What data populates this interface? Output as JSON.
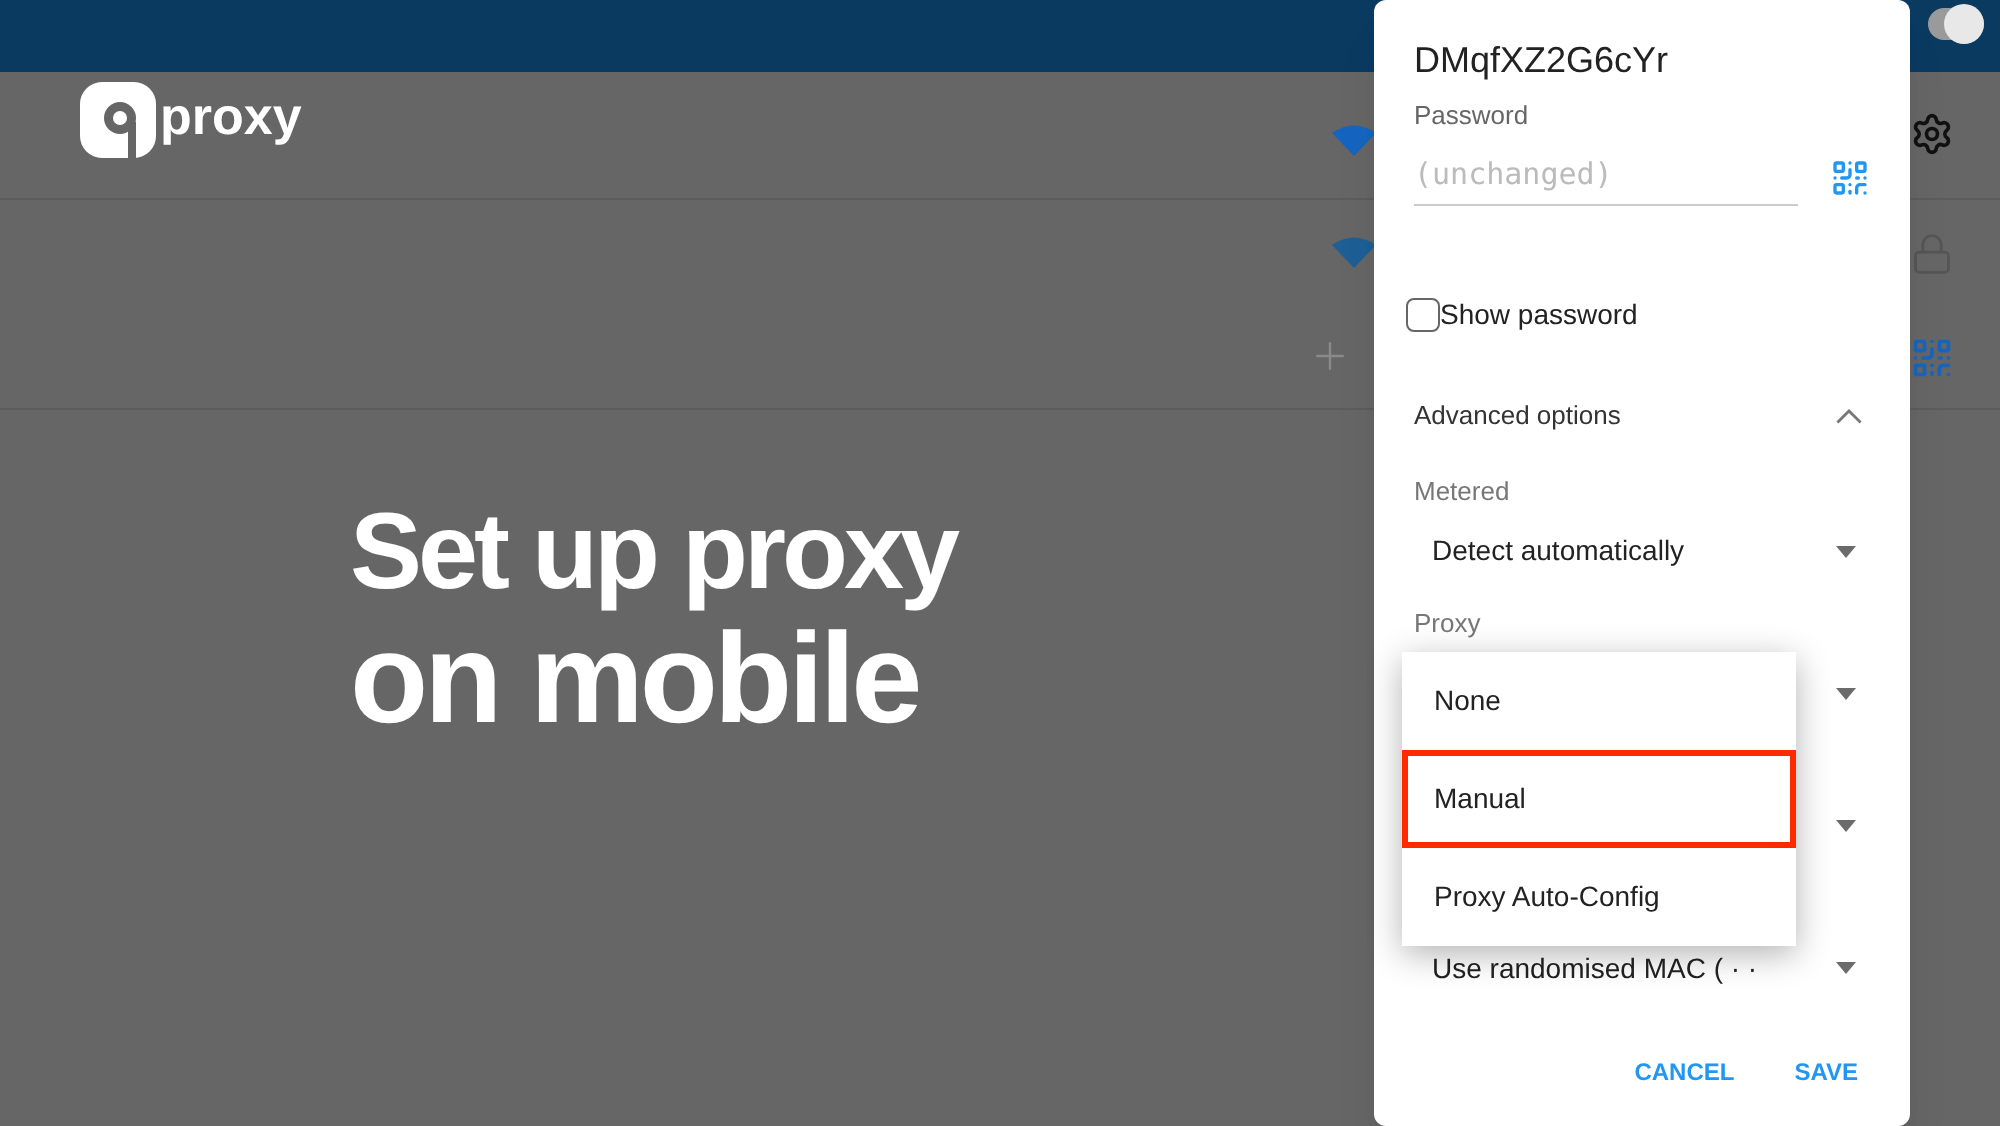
{
  "brand": {
    "logo_text": "proxy"
  },
  "top_toggle": {
    "on": true
  },
  "headline": [
    "Set up proxy",
    "on mobile"
  ],
  "dialog": {
    "network_name": "DMqfXZ2G6cYr",
    "password": {
      "label": "Password",
      "placeholder": "(unchanged)"
    },
    "show_password": {
      "label": "Show password",
      "checked": false
    },
    "advanced": {
      "label": "Advanced options",
      "expanded": true
    },
    "metered": {
      "label": "Metered",
      "value": "Detect automatically"
    },
    "proxy": {
      "label": "Proxy"
    },
    "privacy": {
      "value": "Use randomised MAC ( · ·"
    },
    "buttons": [
      "CANCEL",
      "SAVE"
    ]
  },
  "proxy_menu": [
    {
      "label": "None",
      "selected": false
    },
    {
      "label": "Manual",
      "selected": true
    },
    {
      "label": "Proxy Auto-Config",
      "selected": false
    }
  ]
}
